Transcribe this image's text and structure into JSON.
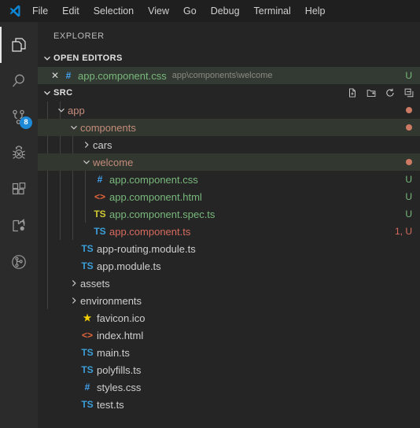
{
  "app": {
    "title": "Visual Studio Code",
    "logo_icon": "vscode-logo"
  },
  "menubar": {
    "items": [
      {
        "label": "File"
      },
      {
        "label": "Edit"
      },
      {
        "label": "Selection"
      },
      {
        "label": "View"
      },
      {
        "label": "Go"
      },
      {
        "label": "Debug"
      },
      {
        "label": "Terminal"
      },
      {
        "label": "Help"
      }
    ]
  },
  "activitybar": {
    "items": [
      {
        "name": "explorer",
        "icon": "files-icon",
        "active": true,
        "badge": ""
      },
      {
        "name": "search",
        "icon": "search-icon",
        "active": false,
        "badge": ""
      },
      {
        "name": "source-control",
        "icon": "source-control-icon",
        "active": false,
        "badge": "8"
      },
      {
        "name": "debug",
        "icon": "debug-icon",
        "active": false,
        "badge": ""
      },
      {
        "name": "extensions",
        "icon": "extensions-icon",
        "active": false,
        "badge": ""
      },
      {
        "name": "live-share",
        "icon": "live-share-icon",
        "active": false,
        "badge": ""
      },
      {
        "name": "gitlens",
        "icon": "git-graph-icon",
        "active": false,
        "badge": ""
      }
    ]
  },
  "sidebar": {
    "title": "EXPLORER",
    "open_editors": {
      "header": "OPEN EDITORS",
      "expanded": true,
      "items": [
        {
          "name": "app.component.css",
          "path": "app\\components\\welcome",
          "icon": "css-file-icon",
          "icon_glyph": "#",
          "badge": "U",
          "state": "added",
          "close_icon": "close-icon"
        }
      ]
    },
    "src": {
      "header": "SRC",
      "expanded": true,
      "actions": [
        {
          "name": "new-file-button",
          "icon": "new-file-icon"
        },
        {
          "name": "new-folder-button",
          "icon": "new-folder-icon"
        },
        {
          "name": "refresh-button",
          "icon": "refresh-icon"
        },
        {
          "name": "collapse-all-button",
          "icon": "collapse-all-icon"
        }
      ],
      "tree": [
        {
          "label": "app",
          "type": "folder",
          "expanded": true,
          "depth": 1,
          "state": "modified",
          "dot": true
        },
        {
          "label": "components",
          "type": "folder",
          "expanded": true,
          "depth": 2,
          "state": "modified",
          "dot": true,
          "highlight": true
        },
        {
          "label": "cars",
          "type": "folder",
          "expanded": false,
          "depth": 3,
          "state": "normal",
          "dot": false
        },
        {
          "label": "welcome",
          "type": "folder",
          "expanded": true,
          "depth": 3,
          "state": "modified",
          "dot": true,
          "highlight": true
        },
        {
          "label": "app.component.css",
          "type": "file",
          "icon": "css-file-icon",
          "icon_glyph": "#",
          "depth": 4,
          "state": "added",
          "badge": "U"
        },
        {
          "label": "app.component.html",
          "type": "file",
          "icon": "html-file-icon",
          "icon_glyph": "<>",
          "depth": 4,
          "state": "added",
          "badge": "U"
        },
        {
          "label": "app.component.spec.ts",
          "type": "file",
          "icon": "typescript-test-file-icon",
          "icon_glyph": "TS",
          "depth": 4,
          "state": "added",
          "badge": "U"
        },
        {
          "label": "app.component.ts",
          "type": "file",
          "icon": "typescript-file-icon",
          "icon_glyph": "TS",
          "depth": 4,
          "state": "modified-error",
          "badge": "1, U"
        },
        {
          "label": "app-routing.module.ts",
          "type": "file",
          "icon": "typescript-file-icon",
          "icon_glyph": "TS",
          "depth": 3,
          "state": "normal",
          "badge": ""
        },
        {
          "label": "app.module.ts",
          "type": "file",
          "icon": "typescript-file-icon",
          "icon_glyph": "TS",
          "depth": 3,
          "state": "normal",
          "badge": ""
        },
        {
          "label": "assets",
          "type": "folder",
          "expanded": false,
          "depth": 2,
          "state": "normal",
          "dot": false
        },
        {
          "label": "environments",
          "type": "folder",
          "expanded": false,
          "depth": 2,
          "state": "normal",
          "dot": false
        },
        {
          "label": "favicon.ico",
          "type": "file",
          "icon": "favicon-star-icon",
          "icon_glyph": "★",
          "depth": 2,
          "state": "normal",
          "badge": ""
        },
        {
          "label": "index.html",
          "type": "file",
          "icon": "html-file-icon",
          "icon_glyph": "<>",
          "depth": 2,
          "state": "normal",
          "badge": ""
        },
        {
          "label": "main.ts",
          "type": "file",
          "icon": "typescript-file-icon",
          "icon_glyph": "TS",
          "depth": 2,
          "state": "normal",
          "badge": ""
        },
        {
          "label": "polyfills.ts",
          "type": "file",
          "icon": "typescript-file-icon",
          "icon_glyph": "TS",
          "depth": 2,
          "state": "normal",
          "badge": ""
        },
        {
          "label": "styles.css",
          "type": "file",
          "icon": "css-file-icon",
          "icon_glyph": "#",
          "depth": 2,
          "state": "normal",
          "badge": ""
        },
        {
          "label": "test.ts",
          "type": "file",
          "icon": "typescript-file-icon",
          "icon_glyph": "TS",
          "depth": 2,
          "state": "normal",
          "badge": ""
        }
      ]
    }
  },
  "colors": {
    "accent_blue": "#1d8ad8",
    "added_green": "#78b87a",
    "modified_orange": "#c58c7c",
    "error_red": "#d66b5e",
    "sidebar_bg": "#252526",
    "activitybar_bg": "#2b2b2b",
    "menubar_bg": "#1f1f20"
  }
}
